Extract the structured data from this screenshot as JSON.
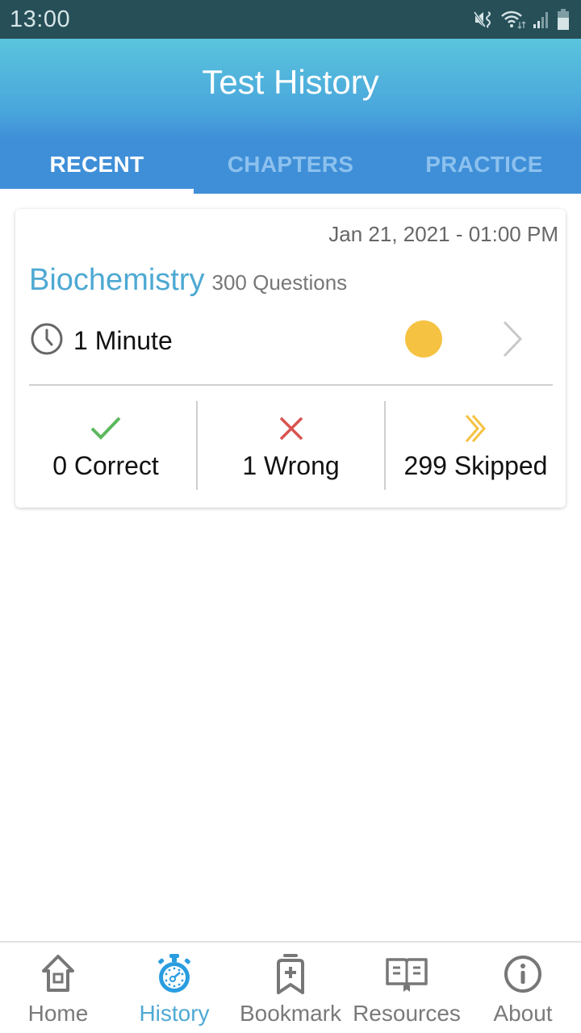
{
  "status_bar": {
    "time": "13:00",
    "icons": [
      "mute-vibrate-icon",
      "wifi-icon",
      "signal-icon",
      "battery-icon"
    ]
  },
  "header": {
    "title": "Test History",
    "tabs": [
      {
        "label": "RECENT",
        "active": true
      },
      {
        "label": "CHAPTERS",
        "active": false
      },
      {
        "label": "PRACTICE",
        "active": false
      }
    ]
  },
  "test_card": {
    "date": "Jan 21, 2021 - 01:00 PM",
    "subject": "Biochemistry",
    "question_count": "300 Questions",
    "duration": "1 Minute",
    "status_color": "#f5c242",
    "stats": [
      {
        "label": "0 Correct",
        "icon": "checkmark-icon",
        "color": "#5cb85c"
      },
      {
        "label": "1 Wrong",
        "icon": "cross-icon",
        "color": "#d9534f"
      },
      {
        "label": "299 Skipped",
        "icon": "double-chevron-icon",
        "color": "#f5c242"
      }
    ]
  },
  "bottom_nav": {
    "active_color": "#4ea9d3",
    "items": [
      {
        "label": "Home",
        "icon": "home-icon",
        "active": false
      },
      {
        "label": "History",
        "icon": "stopwatch-icon",
        "active": true
      },
      {
        "label": "Bookmark",
        "icon": "bookmark-icon",
        "active": false
      },
      {
        "label": "Resources",
        "icon": "book-icon",
        "active": false
      },
      {
        "label": "About",
        "icon": "info-icon",
        "active": false
      }
    ]
  }
}
